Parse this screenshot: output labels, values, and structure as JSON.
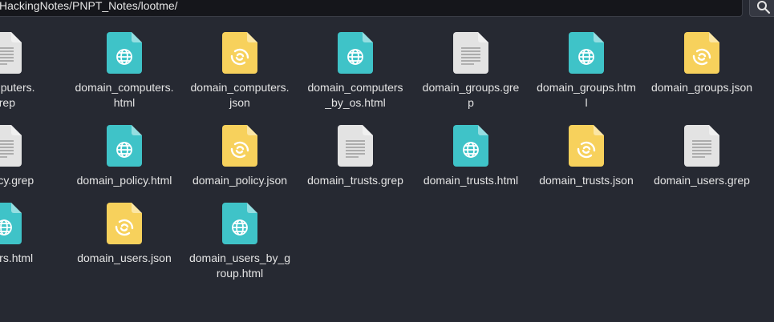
{
  "location_bar": {
    "path": "HackingNotes/PNPT_Notes/lootme/"
  },
  "icon_colors": {
    "html": "#3fc3c8",
    "json": "#f7d15c",
    "grep": "#e3e3e3"
  },
  "files": [
    {
      "name_lines": [
        "_computers.",
        "grep"
      ],
      "type": "grep"
    },
    {
      "name_lines": [
        "domain_computers.",
        "html"
      ],
      "type": "html"
    },
    {
      "name_lines": [
        "domain_computers.",
        "json"
      ],
      "type": "json"
    },
    {
      "name_lines": [
        "domain_computers",
        "_by_os.html"
      ],
      "type": "html"
    },
    {
      "name_lines": [
        "domain_groups.gre",
        "p"
      ],
      "type": "grep"
    },
    {
      "name_lines": [
        "domain_groups.htm",
        "l"
      ],
      "type": "html"
    },
    {
      "name_lines": [
        "domain_groups.json"
      ],
      "type": "json"
    },
    {
      "name_lines": [
        "_policy.grep"
      ],
      "type": "grep"
    },
    {
      "name_lines": [
        "domain_policy.html"
      ],
      "type": "html"
    },
    {
      "name_lines": [
        "domain_policy.json"
      ],
      "type": "json"
    },
    {
      "name_lines": [
        "domain_trusts.grep"
      ],
      "type": "grep"
    },
    {
      "name_lines": [
        "domain_trusts.html"
      ],
      "type": "html"
    },
    {
      "name_lines": [
        "domain_trusts.json"
      ],
      "type": "json"
    },
    {
      "name_lines": [
        "domain_users.grep"
      ],
      "type": "grep"
    },
    {
      "name_lines": [
        "_users.html"
      ],
      "type": "html"
    },
    {
      "name_lines": [
        "domain_users.json"
      ],
      "type": "json"
    },
    {
      "name_lines": [
        "domain_users_by_g",
        "roup.html"
      ],
      "type": "html"
    }
  ]
}
